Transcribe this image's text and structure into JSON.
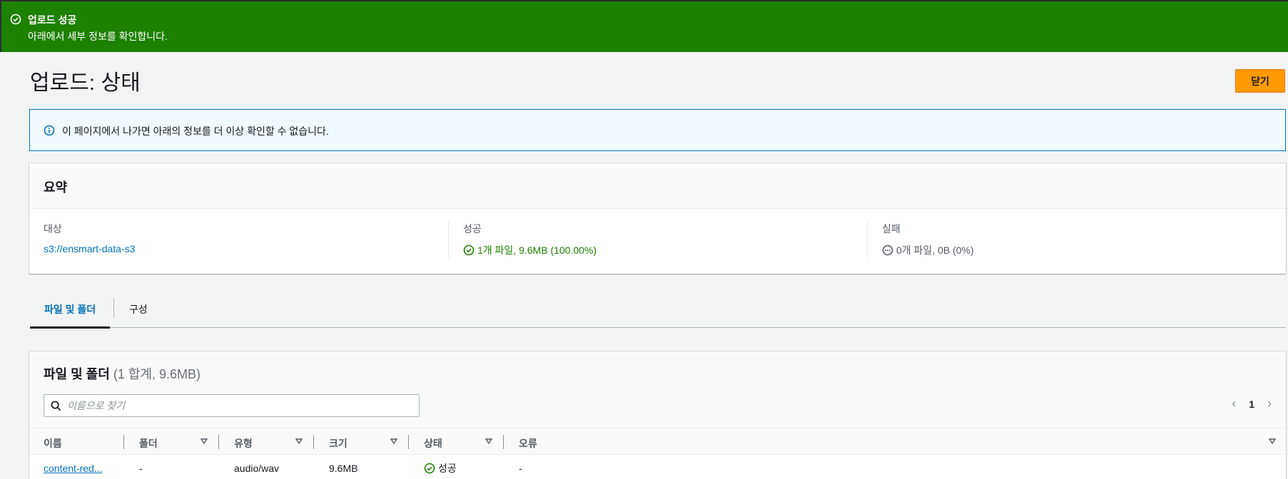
{
  "flash": {
    "title": "업로드 성공",
    "message": "아래에서 세부 정보를 확인합니다."
  },
  "page": {
    "title": "업로드: 상태",
    "close_label": "닫기"
  },
  "info_alert": {
    "text": "이 페이지에서 나가면 아래의 정보를 더 이상 확인할 수 없습니다."
  },
  "summary": {
    "title": "요약",
    "destination_label": "대상",
    "destination_value": "s3://ensmart-data-s3",
    "success_label": "성공",
    "success_value": "1개 파일, 9.6MB (100.00%)",
    "failed_label": "실패",
    "failed_value": "0개 파일, 0B (0%)"
  },
  "tabs": [
    {
      "label": "파일 및 폴더",
      "active": true
    },
    {
      "label": "구성",
      "active": false
    }
  ],
  "files": {
    "title": "파일 및 폴더",
    "count": "(1 합계, 9.6MB)",
    "search_placeholder": "이름으로 찾기",
    "page": "1",
    "columns": [
      "이름",
      "폴더",
      "유형",
      "크기",
      "상태",
      "오류"
    ],
    "rows": [
      {
        "name": "content-red...",
        "folder": "-",
        "type": "audio/wav",
        "size": "9.6MB",
        "status": "성공",
        "error": "-"
      }
    ]
  },
  "colors": {
    "success_green": "#1d8102",
    "link_blue": "#0073bb",
    "primary_orange": "#ff9900",
    "info_border": "#0073bb"
  }
}
